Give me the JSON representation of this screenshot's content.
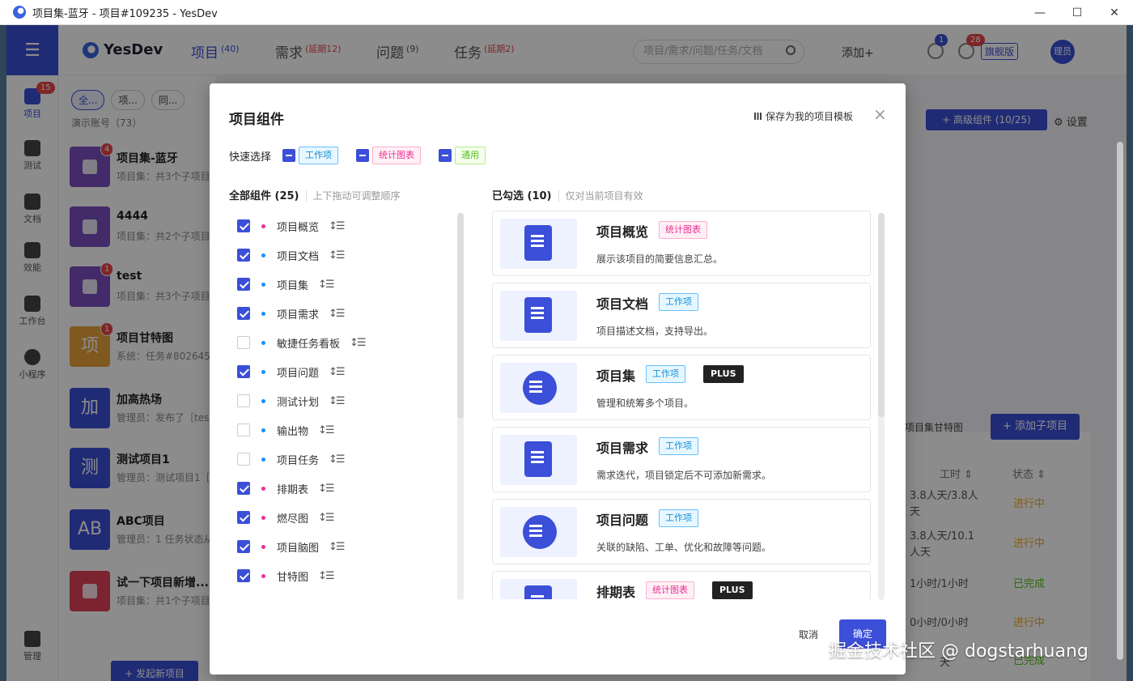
{
  "window": {
    "title": "项目集-蓝牙 - 项目#109235 - YesDev",
    "controls": {
      "minimize": "—",
      "maximize": "☐",
      "close": "✕"
    }
  },
  "rail": {
    "items": [
      {
        "label": "项目",
        "badge": "15",
        "icon": "cube-icon"
      },
      {
        "label": "测试",
        "icon": "test-icon"
      },
      {
        "label": "文档",
        "icon": "doc-icon"
      },
      {
        "label": "效能",
        "icon": "chart-icon"
      },
      {
        "label": "工作台",
        "icon": "workbench-icon"
      },
      {
        "label": "小程序",
        "icon": "qrcode-icon"
      }
    ],
    "bottom": "管理"
  },
  "header": {
    "logo": "YesDev",
    "tabs": [
      {
        "label": "项目",
        "count": "(40)"
      },
      {
        "label": "需求",
        "count": "(延期12)"
      },
      {
        "label": "问题",
        "count": "(9)"
      },
      {
        "label": "任务",
        "count": "(延期2)"
      }
    ],
    "search_placeholder": "项目/需求/问题/任务/文档",
    "add_label": "添加+",
    "notify_badge": "1",
    "alarm_badge": "28",
    "edition": "旗舰版",
    "avatar": "理员"
  },
  "list": {
    "pills": [
      "全...",
      "项...",
      "同..."
    ],
    "account": "演示账号（73）",
    "projects": [
      {
        "name": "项目集-蓝牙",
        "desc": "项目集：共3个子项目",
        "badge": "4",
        "thumb": "",
        "color": "#7b4fbf"
      },
      {
        "name": "4444",
        "desc": "项目集：共2个子项目",
        "badge": "",
        "thumb": "",
        "color": "#7b4fbf"
      },
      {
        "name": "test",
        "desc": "项目集：共3个子项目",
        "badge": "1",
        "thumb": "",
        "color": "#7b4fbf"
      },
      {
        "name": "项目甘特图",
        "desc": "系统：任务#8026454",
        "badge": "1",
        "thumb": "项",
        "color": "#e8a23a"
      },
      {
        "name": "加高热场",
        "desc": "管理员：发布了［tes",
        "badge": "",
        "thumb": "加",
        "color": "#3b4fd8"
      },
      {
        "name": "测试项目1",
        "desc": "管理员：测试项目1［",
        "badge": "",
        "thumb": "测",
        "color": "#3b4fd8"
      },
      {
        "name": "ABC项目",
        "desc": "管理员：1 任务状态从",
        "badge": "",
        "thumb": "AB",
        "color": "#3b4fd8"
      },
      {
        "name": "试一下项目新增...",
        "desc": "项目集：共1个子项目",
        "badge": "",
        "thumb": "",
        "color": "#e0405a"
      }
    ],
    "new_button": "+ 发起新项目"
  },
  "background": {
    "advanced_button": "+ 高级组件 (10/25)",
    "settings": "设置",
    "gantt_link": "项目集甘特图",
    "add_sub_button": "+ 添加子项目",
    "col_hours": "工时 ⇕",
    "col_status": "状态 ⇕",
    "rows": [
      {
        "hours": "3.8人天/3.8人天",
        "status": "进行中"
      },
      {
        "hours": "3.8人天/10.1人天",
        "status": "进行中"
      },
      {
        "hours": "1小时/1小时",
        "status": "已完成"
      },
      {
        "hours": "0小时/0小时",
        "status": "进行中"
      },
      {
        "hours": "天",
        "status": "已完成"
      }
    ]
  },
  "modal": {
    "title": "项目组件",
    "save_template": "保存为我的项目模板",
    "close": "×",
    "quick_label": "快速选择",
    "quick_options": [
      "工作项",
      "统计图表",
      "通用"
    ],
    "all_title": "全部组件 (25)",
    "all_hint": "上下拖动可调整顺序",
    "selected_title": "已勾选 (10)",
    "selected_hint": "仅对当前项目有效",
    "components": [
      {
        "label": "项目概览",
        "checked": true,
        "dot": "pink"
      },
      {
        "label": "项目文档",
        "checked": true,
        "dot": "blue"
      },
      {
        "label": "项目集",
        "checked": true,
        "dot": "blue"
      },
      {
        "label": "项目需求",
        "checked": true,
        "dot": "blue"
      },
      {
        "label": "敏捷任务看板",
        "checked": false,
        "dot": "blue"
      },
      {
        "label": "项目问题",
        "checked": true,
        "dot": "blue"
      },
      {
        "label": "测试计划",
        "checked": false,
        "dot": "blue"
      },
      {
        "label": "输出物",
        "checked": false,
        "dot": "blue"
      },
      {
        "label": "项目任务",
        "checked": false,
        "dot": "blue"
      },
      {
        "label": "排期表",
        "checked": true,
        "dot": "pink"
      },
      {
        "label": "燃尽图",
        "checked": true,
        "dot": "pink"
      },
      {
        "label": "项目脑图",
        "checked": true,
        "dot": "pink"
      },
      {
        "label": "甘特图",
        "checked": true,
        "dot": "pink"
      }
    ],
    "drag_glyph": "↕☰",
    "selected": [
      {
        "title": "项目概览",
        "tag": "统计图表",
        "tag_type": "chart",
        "plus": "",
        "desc": "展示该项目的简要信息汇总。",
        "icon": "overview-doc-icon"
      },
      {
        "title": "项目文档",
        "tag": "工作项",
        "tag_type": "work",
        "plus": "",
        "desc": "项目描述文档，支持导出。",
        "icon": "folder-doc-icon"
      },
      {
        "title": "项目集",
        "tag": "工作项",
        "tag_type": "work",
        "plus": "PLUS",
        "desc": "管理和统筹多个项目。",
        "icon": "chat-bubble-icon"
      },
      {
        "title": "项目需求",
        "tag": "工作项",
        "tag_type": "work",
        "plus": "",
        "desc": "需求迭代，项目锁定后不可添加新需求。",
        "icon": "inbox-doc-icon"
      },
      {
        "title": "项目问题",
        "tag": "工作项",
        "tag_type": "work",
        "plus": "",
        "desc": "关联的缺陷、工单、优化和故障等问题。",
        "icon": "question-icon"
      },
      {
        "title": "排期表",
        "tag": "统计图表",
        "tag_type": "chart",
        "plus": "PLUS",
        "desc": "",
        "icon": "calendar-icon"
      }
    ],
    "cancel": "取消",
    "ok": "确定"
  },
  "credit": "掘金技术社区 @ dogstarhuang"
}
